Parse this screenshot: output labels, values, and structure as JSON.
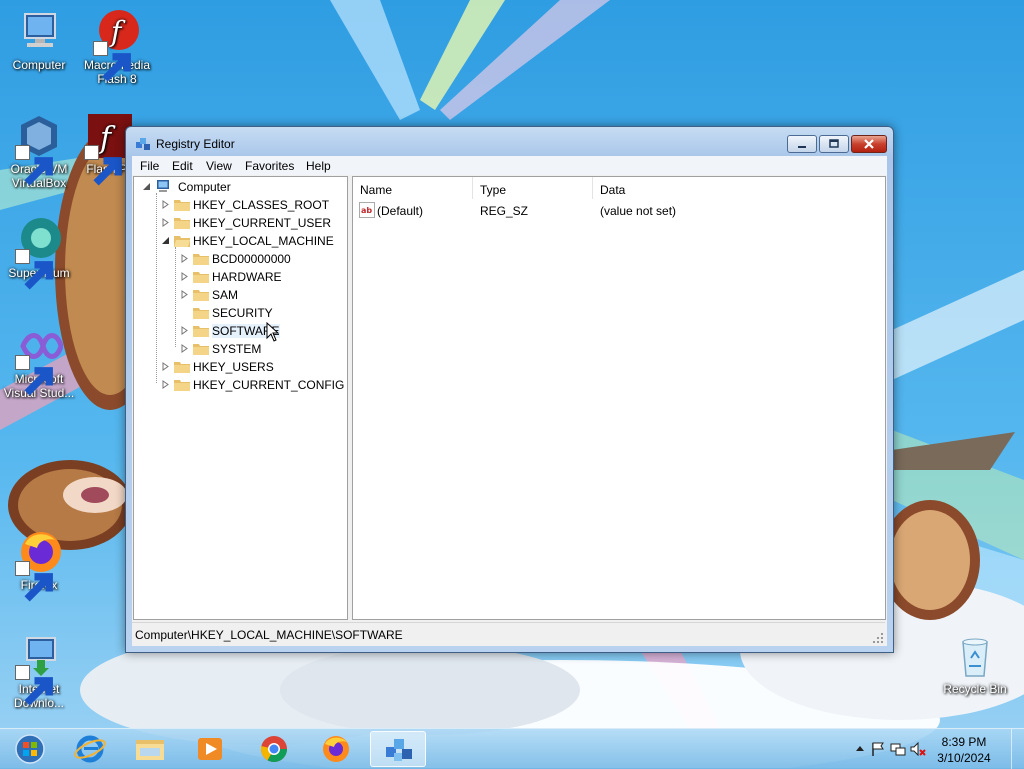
{
  "desktop": {
    "icons": [
      {
        "label": "Computer"
      },
      {
        "label": "Macromedia Flash 8"
      },
      {
        "label": "Oracle VM VirtualBox"
      },
      {
        "label": "Flash Pl"
      },
      {
        "label": "Supermium"
      },
      {
        "label": "Microsoft Visual Stud..."
      },
      {
        "label": "Firefox"
      },
      {
        "label": "Internet Downlo..."
      },
      {
        "label": "Recycle Bin"
      }
    ]
  },
  "window": {
    "title": "Registry Editor",
    "menu": [
      "File",
      "Edit",
      "View",
      "Favorites",
      "Help"
    ],
    "tree": {
      "root": "Computer",
      "hives": [
        "HKEY_CLASSES_ROOT",
        "HKEY_CURRENT_USER",
        "HKEY_LOCAL_MACHINE",
        "HKEY_USERS",
        "HKEY_CURRENT_CONFIG"
      ],
      "local_machine_children": [
        "BCD00000000",
        "HARDWARE",
        "SAM",
        "SECURITY",
        "SOFTWARE",
        "SYSTEM"
      ]
    },
    "list": {
      "columns": [
        "Name",
        "Type",
        "Data"
      ],
      "rows": [
        {
          "name": "(Default)",
          "type": "REG_SZ",
          "data": "(value not set)"
        }
      ]
    },
    "status": "Computer\\HKEY_LOCAL_MACHINE\\SOFTWARE"
  },
  "taskbar": {
    "time": "8:39 PM",
    "date": "3/10/2024"
  },
  "colors": {
    "sky": "#3ea6e6",
    "taskbar": "#8cc3ea",
    "close_button": "#c8412d"
  }
}
